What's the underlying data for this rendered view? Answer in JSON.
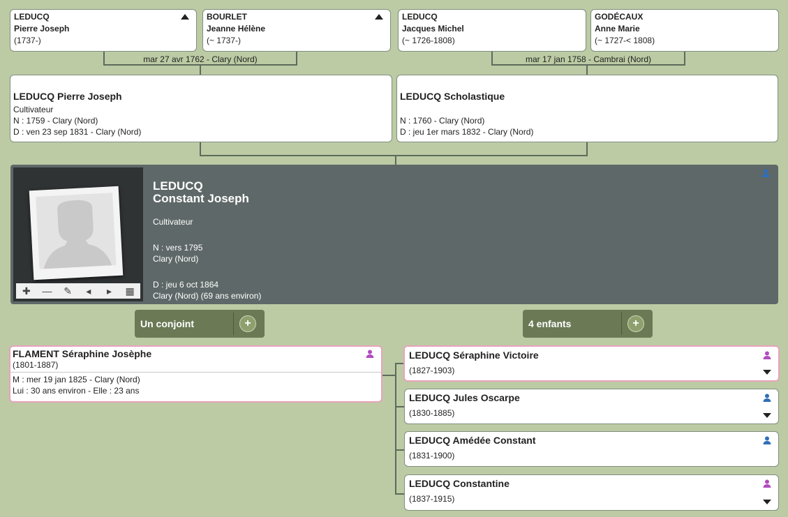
{
  "grandparents": [
    {
      "surname": "LEDUCQ",
      "given": "Pierre Joseph",
      "dates": "(1737-)"
    },
    {
      "surname": "BOURLET",
      "given": "Jeanne Hélène",
      "dates": "(~ 1737-)"
    },
    {
      "surname": "LEDUCQ",
      "given": "Jacques Michel",
      "dates": "(~ 1726-1808)"
    },
    {
      "surname": "GODÉCAUX",
      "given": "Anne Marie",
      "dates": "(~ 1727-< 1808)"
    }
  ],
  "marriages": [
    {
      "label": "mar 27 avr 1762 - Clary (Nord)"
    },
    {
      "label": "mar 17 jan 1758 - Cambrai (Nord)"
    }
  ],
  "parents": [
    {
      "name": "LEDUCQ Pierre Joseph",
      "occupation": "Cultivateur",
      "birth": "N : 1759 - Clary (Nord)",
      "death": "D : ven 23 sep 1831 - Clary (Nord)"
    },
    {
      "name": "LEDUCQ Scholastique",
      "occupation": "",
      "birth": "N : 1760 - Clary (Nord)",
      "death": "D : jeu 1er mars 1832 - Clary (Nord)"
    }
  ],
  "main": {
    "surname": "LEDUCQ",
    "given": "Constant Joseph",
    "occupation": "Cultivateur",
    "birth_date": "N : vers 1795",
    "birth_place": "Clary (Nord)",
    "death_date": "D : jeu 6 oct 1864",
    "death_place": "Clary (Nord) (69 ans environ)"
  },
  "buttons": {
    "spouses": "Un conjoint",
    "children": "4 enfants"
  },
  "spouse": {
    "name": "FLAMENT Séraphine Josèphe",
    "dates": "(1801-1887)",
    "marriage": "M : mer 19 jan 1825 - Clary (Nord)",
    "ages": "Lui : 30 ans environ - Elle : 23 ans"
  },
  "children": [
    {
      "name": "LEDUCQ Séraphine Victoire",
      "dates": "(1827-1903)",
      "sex": "female"
    },
    {
      "name": "LEDUCQ Jules Oscarpe",
      "dates": "(1830-1885)",
      "sex": "male"
    },
    {
      "name": "LEDUCQ Amédée Constant",
      "dates": "(1831-1900)",
      "sex": "male"
    },
    {
      "name": "LEDUCQ Constantine",
      "dates": "(1837-1915)",
      "sex": "female"
    }
  ],
  "colors": {
    "background": "#bccba4",
    "main_panel": "#5f6868",
    "female": "#b24bc0",
    "male": "#2f6fb8",
    "button": "#6b7a55"
  }
}
